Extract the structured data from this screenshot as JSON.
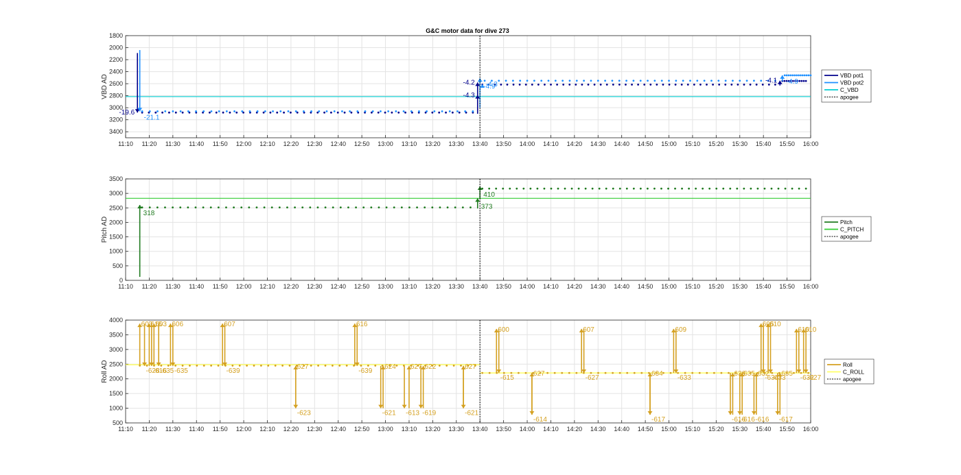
{
  "chart_data": [
    {
      "type": "line",
      "title": "G&C motor data for dive 273",
      "ylabel": "VBD AD",
      "xlabel": "",
      "ylim": [
        1800,
        3500
      ],
      "y_reversed": true,
      "yticks": [
        1800,
        2000,
        2200,
        2400,
        2600,
        2800,
        3000,
        3200,
        3400
      ],
      "xlim": [
        "11:10",
        "16:00"
      ],
      "xticks": [
        "11:10",
        "11:20",
        "11:30",
        "11:40",
        "11:50",
        "12:00",
        "12:10",
        "12:20",
        "12:30",
        "12:40",
        "12:50",
        "13:00",
        "13:10",
        "13:20",
        "13:30",
        "13:40",
        "13:50",
        "14:00",
        "14:10",
        "14:20",
        "14:30",
        "14:40",
        "14:50",
        "15:00",
        "15:10",
        "15:20",
        "15:30",
        "15:40",
        "15:50",
        "16:00"
      ],
      "grid": true,
      "legend": {
        "placement": "right",
        "entries": [
          "VBD pot1",
          "VBD pot2",
          "C_VBD",
          "apogee"
        ]
      },
      "colors": {
        "VBD pot1": "#00008b",
        "VBD pot2": "#1e90ff",
        "C_VBD": "#00ced1",
        "apogee": "#000000"
      },
      "series": [
        {
          "name": "C_VBD",
          "kind": "hline",
          "y": 2815
        },
        {
          "name": "VBD pot1",
          "kind": "dots",
          "segments": [
            {
              "t0": "11:17",
              "t1": "13:37",
              "y": 3080,
              "n": 50
            },
            {
              "t0": "13:41",
              "t1": "15:45",
              "y": 2615,
              "n": 48
            },
            {
              "t0": "15:48",
              "t1": "15:58",
              "y": 2555,
              "n": 12
            }
          ]
        },
        {
          "name": "VBD pot2",
          "kind": "dots",
          "segments": [
            {
              "t0": "11:17",
              "t1": "13:37",
              "y": 3060,
              "n": 44
            },
            {
              "t0": "13:42",
              "t1": "15:45",
              "y": 2550,
              "n": 42
            },
            {
              "t0": "15:49",
              "t1": "16:00",
              "y": 2460,
              "n": 14
            }
          ]
        }
      ],
      "arrows": [
        {
          "series": "VBD pot1",
          "t": "11:15",
          "y_from": 2090,
          "y_to": 3080,
          "label": "-19.6",
          "label_pos": "left"
        },
        {
          "series": "VBD pot2",
          "t": "11:16",
          "y_from": 2040,
          "y_to": 3060,
          "label": "-21.1",
          "label_pos": "below"
        },
        {
          "series": "VBD pot1",
          "t": "13:39",
          "y_from": 3100,
          "y_to": 2790,
          "label": "-4.3",
          "label_pos": "left"
        },
        {
          "series": "VBD pot1",
          "t": "13:39",
          "y_from": 2840,
          "y_to": 2580,
          "label": "-4.2",
          "label_pos": "left"
        },
        {
          "series": "VBD pot2",
          "t": "13:40",
          "y_from": 3000,
          "y_to": 2510,
          "label": "-4.9",
          "label_pos": "below-right"
        },
        {
          "series": "VBD pot2",
          "t": "13:41",
          "y_from": 2640,
          "y_to": 2610,
          "label": "-4.3",
          "label_pos": "right"
        },
        {
          "series": "VBD pot1",
          "t": "15:47",
          "y_from": 2630,
          "y_to": 2550,
          "label": "-4.1",
          "label_pos": "left"
        },
        {
          "series": "VBD pot2",
          "t": "15:48",
          "y_from": 2560,
          "y_to": 2460,
          "label": "-4.9",
          "label_pos": "below"
        }
      ]
    },
    {
      "type": "line",
      "title": "",
      "ylabel": "Pitch AD",
      "xlabel": "",
      "ylim": [
        0,
        3500
      ],
      "yticks": [
        0,
        500,
        1000,
        1500,
        2000,
        2500,
        3000,
        3500
      ],
      "xlim": [
        "11:10",
        "16:00"
      ],
      "xticks": [
        "11:10",
        "11:20",
        "11:30",
        "11:40",
        "11:50",
        "12:00",
        "12:10",
        "12:20",
        "12:30",
        "12:40",
        "12:50",
        "13:00",
        "13:10",
        "13:20",
        "13:30",
        "13:40",
        "13:50",
        "14:00",
        "14:10",
        "14:20",
        "14:30",
        "14:40",
        "14:50",
        "15:00",
        "15:10",
        "15:20",
        "15:30",
        "15:40",
        "15:50",
        "16:00"
      ],
      "grid": true,
      "legend": {
        "placement": "right",
        "entries": [
          "Pitch",
          "C_PITCH",
          "apogee"
        ]
      },
      "colors": {
        "Pitch": "#1f7a1f",
        "C_PITCH": "#32cd32",
        "apogee": "#000000"
      },
      "series": [
        {
          "name": "C_PITCH",
          "kind": "hline",
          "y": 2830
        },
        {
          "name": "Pitch",
          "kind": "dots",
          "segments": [
            {
              "t0": "11:17",
              "t1": "13:36",
              "y": 2515,
              "n": 44
            },
            {
              "t0": "13:41",
              "t1": "15:58",
              "y": 3165,
              "n": 48
            }
          ]
        }
      ],
      "arrows": [
        {
          "series": "Pitch",
          "t": "11:16",
          "y_from": 120,
          "y_to": 2600,
          "label": "318",
          "label_pos": "below-right"
        },
        {
          "series": "Pitch",
          "t": "13:39",
          "y_from": 2480,
          "y_to": 2830,
          "label": "373",
          "label_pos": "below-right"
        },
        {
          "series": "Pitch",
          "t": "13:40",
          "y_from": 2830,
          "y_to": 3240,
          "label": "410",
          "label_pos": "below-right"
        }
      ]
    },
    {
      "type": "line",
      "title": "",
      "ylabel": "Roll AD",
      "xlabel": "",
      "ylim": [
        500,
        4000
      ],
      "yticks": [
        500,
        1000,
        1500,
        2000,
        2500,
        3000,
        3500,
        4000
      ],
      "xlim": [
        "11:10",
        "16:00"
      ],
      "xticks": [
        "11:10",
        "11:20",
        "11:30",
        "11:40",
        "11:50",
        "12:00",
        "12:10",
        "12:20",
        "12:30",
        "12:40",
        "12:50",
        "13:00",
        "13:10",
        "13:20",
        "13:30",
        "13:40",
        "13:50",
        "14:00",
        "14:10",
        "14:20",
        "14:30",
        "14:40",
        "14:50",
        "15:00",
        "15:10",
        "15:20",
        "15:30",
        "15:40",
        "15:50",
        "16:00"
      ],
      "grid": true,
      "legend": {
        "placement": "right",
        "entries": [
          "Roll",
          "C_ROLL",
          "apogee"
        ]
      },
      "colors": {
        "Roll": "#d4a020",
        "C_ROLL": "#ffff66",
        "apogee": "#000000"
      },
      "series": [
        {
          "name": "C_ROLL",
          "kind": "hsegments",
          "segments": [
            {
              "t0": "11:10",
              "t1": "13:40",
              "y": 2480
            },
            {
              "t0": "13:40",
              "t1": "16:00",
              "y": 2200
            }
          ]
        },
        {
          "name": "Roll",
          "kind": "dots",
          "segments": [
            {
              "t0": "11:16",
              "t1": "13:38",
              "y": 2450,
              "n": 48
            },
            {
              "t0": "13:41",
              "t1": "15:59",
              "y": 2200,
              "n": 46
            }
          ]
        }
      ],
      "arrows": [
        {
          "t": "11:16",
          "y_from": 2440,
          "y_to": 3880,
          "label": "603",
          "label_pos": "up"
        },
        {
          "t": "11:18",
          "y_from": 3880,
          "y_to": 2440,
          "label": "-628",
          "label_pos": "down"
        },
        {
          "t": "11:20",
          "y_from": 2440,
          "y_to": 3880,
          "label": "615",
          "label_pos": "up"
        },
        {
          "t": "11:21",
          "y_from": 3880,
          "y_to": 2440,
          "label": "-616",
          "label_pos": "down"
        },
        {
          "t": "11:22",
          "y_from": 2440,
          "y_to": 3880,
          "label": "603",
          "label_pos": "up"
        },
        {
          "t": "11:24",
          "y_from": 3880,
          "y_to": 2440,
          "label": "-635",
          "label_pos": "down"
        },
        {
          "t": "11:29",
          "y_from": 2440,
          "y_to": 3880,
          "label": "606",
          "label_pos": "up"
        },
        {
          "t": "11:30",
          "y_from": 3880,
          "y_to": 2440,
          "label": "-635",
          "label_pos": "down"
        },
        {
          "t": "11:51",
          "y_from": 2440,
          "y_to": 3880,
          "label": "607",
          "label_pos": "up"
        },
        {
          "t": "11:52",
          "y_from": 3880,
          "y_to": 2440,
          "label": "-639",
          "label_pos": "down"
        },
        {
          "t": "12:22",
          "y_from": 2440,
          "y_to": 1000,
          "label": "-623",
          "label_pos": "down"
        },
        {
          "t": "12:22",
          "y_from": 1000,
          "y_to": 2440,
          "label": "627",
          "label_pos": "up"
        },
        {
          "t": "12:47",
          "y_from": 2440,
          "y_to": 3880,
          "label": "616",
          "label_pos": "up"
        },
        {
          "t": "12:48",
          "y_from": 3880,
          "y_to": 2440,
          "label": "-639",
          "label_pos": "down"
        },
        {
          "t": "12:58",
          "y_from": 2440,
          "y_to": 1000,
          "label": "-621",
          "label_pos": "down"
        },
        {
          "t": "12:59",
          "y_from": 1000,
          "y_to": 2440,
          "label": "624",
          "label_pos": "up"
        },
        {
          "t": "13:08",
          "y_from": 2440,
          "y_to": 1000,
          "label": "-613",
          "label_pos": "down"
        },
        {
          "t": "13:10",
          "y_from": 1000,
          "y_to": 2440,
          "label": "627",
          "label_pos": "up"
        },
        {
          "t": "13:15",
          "y_from": 2440,
          "y_to": 1000,
          "label": "-619",
          "label_pos": "down"
        },
        {
          "t": "13:16",
          "y_from": 1000,
          "y_to": 2440,
          "label": "622",
          "label_pos": "up"
        },
        {
          "t": "13:33",
          "y_from": 2440,
          "y_to": 1000,
          "label": "-621",
          "label_pos": "down"
        },
        {
          "t": "13:33",
          "y_from": 1000,
          "y_to": 2440,
          "label": "627",
          "label_pos": "up"
        },
        {
          "t": "13:47",
          "y_from": 2200,
          "y_to": 3700,
          "label": "600",
          "label_pos": "up"
        },
        {
          "t": "13:48",
          "y_from": 3700,
          "y_to": 2200,
          "label": "-615",
          "label_pos": "down"
        },
        {
          "t": "14:02",
          "y_from": 2200,
          "y_to": 780,
          "label": "-614",
          "label_pos": "down"
        },
        {
          "t": "14:02",
          "y_from": 780,
          "y_to": 2200,
          "label": "627",
          "label_pos": "up"
        },
        {
          "t": "14:23",
          "y_from": 2200,
          "y_to": 3700,
          "label": "607",
          "label_pos": "up"
        },
        {
          "t": "14:24",
          "y_from": 3700,
          "y_to": 2200,
          "label": "-627",
          "label_pos": "down"
        },
        {
          "t": "14:52",
          "y_from": 2200,
          "y_to": 780,
          "label": "-617",
          "label_pos": "down"
        },
        {
          "t": "14:52",
          "y_from": 780,
          "y_to": 2200,
          "label": "634",
          "label_pos": "up"
        },
        {
          "t": "15:02",
          "y_from": 2200,
          "y_to": 3700,
          "label": "609",
          "label_pos": "up"
        },
        {
          "t": "15:03",
          "y_from": 3700,
          "y_to": 2200,
          "label": "-633",
          "label_pos": "down"
        },
        {
          "t": "15:26",
          "y_from": 2200,
          "y_to": 780,
          "label": "-616",
          "label_pos": "down"
        },
        {
          "t": "15:27",
          "y_from": 780,
          "y_to": 2200,
          "label": "636",
          "label_pos": "up"
        },
        {
          "t": "15:30",
          "y_from": 2200,
          "y_to": 780,
          "label": "-616",
          "label_pos": "down"
        },
        {
          "t": "15:31",
          "y_from": 780,
          "y_to": 2200,
          "label": "635",
          "label_pos": "up"
        },
        {
          "t": "15:36",
          "y_from": 2200,
          "y_to": 780,
          "label": "-616",
          "label_pos": "down"
        },
        {
          "t": "15:37",
          "y_from": 780,
          "y_to": 2200,
          "label": "632",
          "label_pos": "up"
        },
        {
          "t": "15:39",
          "y_from": 2200,
          "y_to": 3880,
          "label": "605",
          "label_pos": "up"
        },
        {
          "t": "15:40",
          "y_from": 3880,
          "y_to": 2200,
          "label": "-634",
          "label_pos": "down"
        },
        {
          "t": "15:42",
          "y_from": 2200,
          "y_to": 3880,
          "label": "610",
          "label_pos": "up"
        },
        {
          "t": "15:43",
          "y_from": 3880,
          "y_to": 2200,
          "label": "-633",
          "label_pos": "down"
        },
        {
          "t": "15:46",
          "y_from": 2200,
          "y_to": 780,
          "label": "-617",
          "label_pos": "down"
        },
        {
          "t": "15:47",
          "y_from": 780,
          "y_to": 2200,
          "label": "635",
          "label_pos": "up"
        },
        {
          "t": "15:54",
          "y_from": 2200,
          "y_to": 3700,
          "label": "610",
          "label_pos": "up"
        },
        {
          "t": "15:55",
          "y_from": 3700,
          "y_to": 2200,
          "label": "-632",
          "label_pos": "down"
        },
        {
          "t": "15:57",
          "y_from": 2200,
          "y_to": 3700,
          "label": "610",
          "label_pos": "up"
        },
        {
          "t": "15:58",
          "y_from": 3700,
          "y_to": 2200,
          "label": "-627",
          "label_pos": "down"
        }
      ]
    }
  ],
  "apogee": "13:40"
}
